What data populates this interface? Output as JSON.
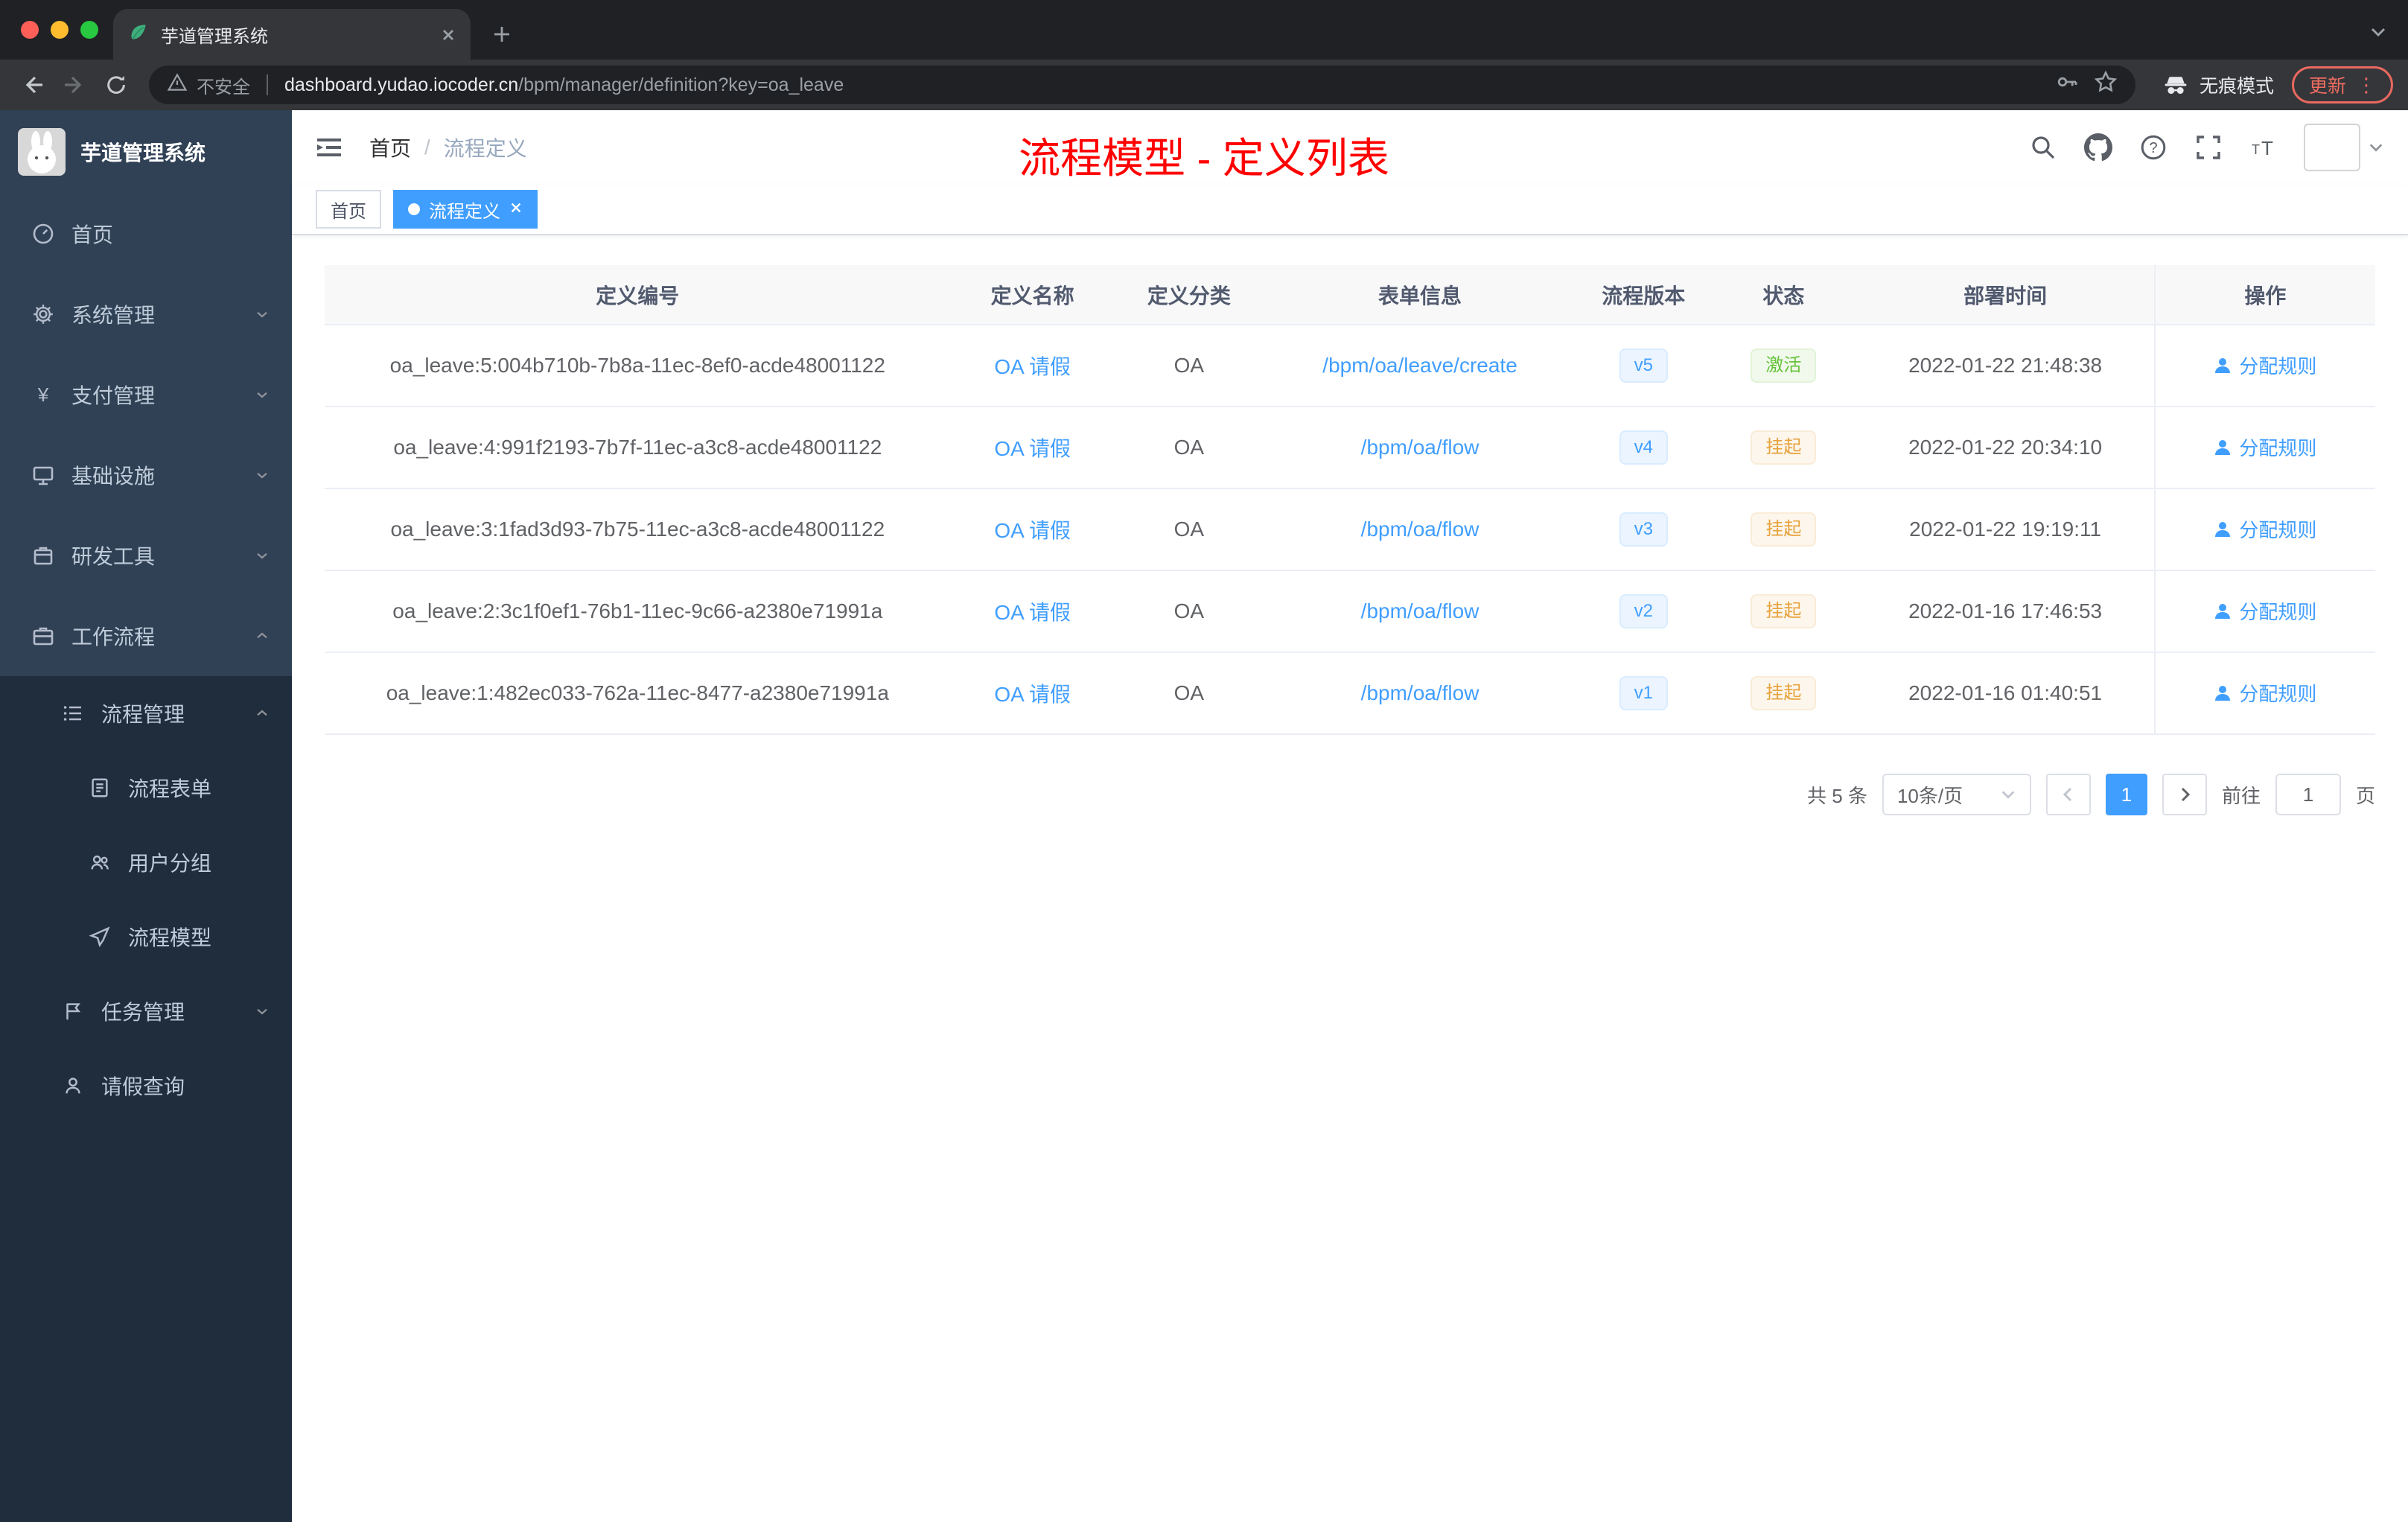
{
  "colors": {
    "accent": "#409eff",
    "success": "#67c23a",
    "warning": "#e6a23c",
    "annotation_red": "#ff0000",
    "sidebar_bg": "#304156",
    "sidebar_submenu_bg": "#1f2d3d"
  },
  "browser": {
    "tab_title": "芋道管理系统",
    "security_label": "不安全",
    "url_host": "dashboard.yudao.iocoder.cn",
    "url_path": "/bpm/manager/definition?key=oa_leave",
    "incognito_label": "无痕模式",
    "update_label": "更新"
  },
  "sidebar": {
    "logo_title": "芋道管理系统",
    "menu": [
      {
        "label": "首页"
      },
      {
        "label": "系统管理"
      },
      {
        "label": "支付管理"
      },
      {
        "label": "基础设施"
      },
      {
        "label": "研发工具"
      },
      {
        "label": "工作流程"
      }
    ],
    "submenu": [
      {
        "label": "流程管理"
      },
      {
        "label": "流程表单"
      },
      {
        "label": "用户分组"
      },
      {
        "label": "流程模型"
      },
      {
        "label": "任务管理"
      },
      {
        "label": "请假查询"
      }
    ]
  },
  "navbar": {
    "breadcrumb": [
      "首页",
      "流程定义"
    ],
    "breadcrumb_sep": "/",
    "annotation": "流程模型 - 定义列表"
  },
  "tags": [
    {
      "label": "首页",
      "active": false
    },
    {
      "label": "流程定义",
      "active": true
    }
  ],
  "table": {
    "columns": [
      "定义编号",
      "定义名称",
      "定义分类",
      "表单信息",
      "流程版本",
      "状态",
      "部署时间",
      "操作"
    ],
    "rows": [
      {
        "id": "oa_leave:5:004b710b-7b8a-11ec-8ef0-acde48001122",
        "name": "OA 请假",
        "category": "OA",
        "form": "/bpm/oa/leave/create",
        "version": "v5",
        "status": "激活",
        "deploy_time": "2022-01-22 21:48:38",
        "action": "分配规则"
      },
      {
        "id": "oa_leave:4:991f2193-7b7f-11ec-a3c8-acde48001122",
        "name": "OA 请假",
        "category": "OA",
        "form": "/bpm/oa/flow",
        "version": "v4",
        "status": "挂起",
        "deploy_time": "2022-01-22 20:34:10",
        "action": "分配规则"
      },
      {
        "id": "oa_leave:3:1fad3d93-7b75-11ec-a3c8-acde48001122",
        "name": "OA 请假",
        "category": "OA",
        "form": "/bpm/oa/flow",
        "version": "v3",
        "status": "挂起",
        "deploy_time": "2022-01-22 19:19:11",
        "action": "分配规则"
      },
      {
        "id": "oa_leave:2:3c1f0ef1-76b1-11ec-9c66-a2380e71991a",
        "name": "OA 请假",
        "category": "OA",
        "form": "/bpm/oa/flow",
        "version": "v2",
        "status": "挂起",
        "deploy_time": "2022-01-16 17:46:53",
        "action": "分配规则"
      },
      {
        "id": "oa_leave:1:482ec033-762a-11ec-8477-a2380e71991a",
        "name": "OA 请假",
        "category": "OA",
        "form": "/bpm/oa/flow",
        "version": "v1",
        "status": "挂起",
        "deploy_time": "2022-01-16 01:40:51",
        "action": "分配规则"
      }
    ]
  },
  "pagination": {
    "total": "共 5 条",
    "page_size": "10条/页",
    "current_page": "1",
    "goto_label": "前往",
    "goto_value": "1",
    "unit": "页"
  }
}
